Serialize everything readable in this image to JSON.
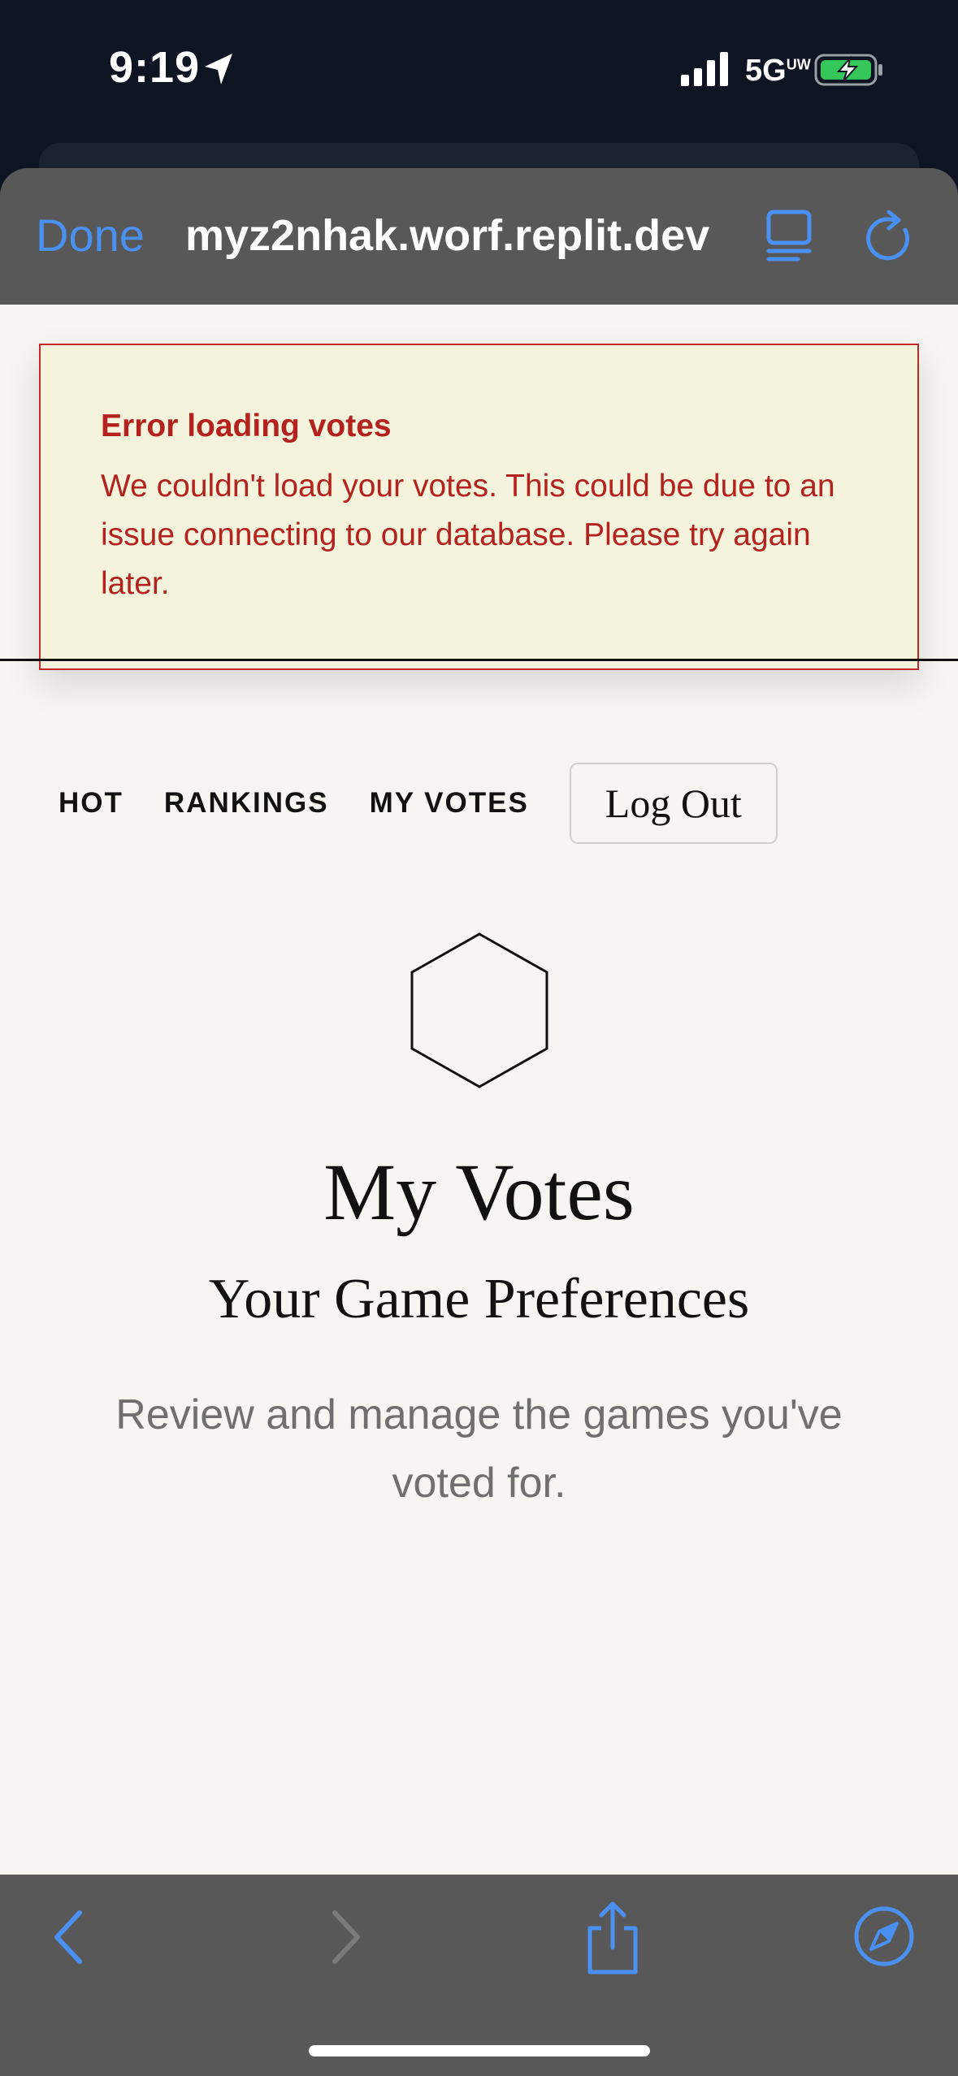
{
  "status_bar": {
    "time": "9:19",
    "network": "5G",
    "network_superscript": "UW"
  },
  "browser": {
    "done_label": "Done",
    "url": "myz2nhak.worf.replit.dev",
    "icons": {
      "reader": "reader-mode-icon",
      "reload": "reload-icon",
      "back": "back-arrow-icon",
      "forward": "forward-arrow-icon",
      "share": "share-icon",
      "safari": "safari-compass-icon"
    },
    "accent_color": "#4a90f0"
  },
  "error_toast": {
    "title": "Error loading votes",
    "message": "We couldn't load your votes. This could be due to an issue connecting to our database. Please try again later.",
    "color": "#b3221f",
    "background": "#f5f3dc"
  },
  "nav": {
    "hot": "HOT",
    "rankings": "RANKINGS",
    "my_votes": "MY VOTES",
    "logout": "Log Out"
  },
  "page": {
    "icon": "hexagon-icon",
    "title": "My Votes",
    "subtitle": "Your Game Preferences",
    "description": "Review and manage the games you've voted for."
  }
}
